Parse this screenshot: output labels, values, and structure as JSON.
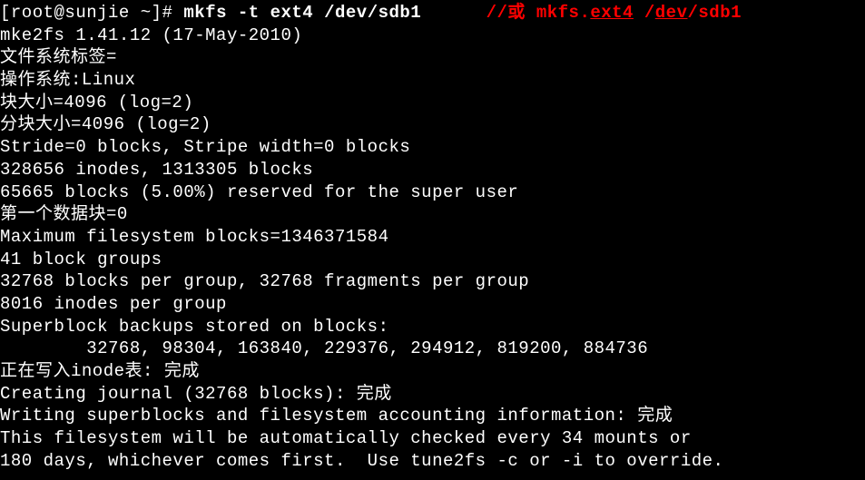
{
  "prompt": {
    "open": "[",
    "userhost": "root@sunjie ~",
    "close": "]# ",
    "command": "mkfs -t ext4 /dev/sdb1",
    "spacer": "      ",
    "comment_prefix": "//或 mkfs.",
    "comment_ext": "ext4",
    "comment_mid": " /",
    "comment_dev": "dev",
    "comment_suffix": "/sdb1"
  },
  "output": {
    "l1": "mke2fs 1.41.12 (17-May-2010)",
    "l2": "文件系统标签=",
    "l3": "操作系统:Linux",
    "l4": "块大小=4096 (log=2)",
    "l5": "分块大小=4096 (log=2)",
    "l6": "Stride=0 blocks, Stripe width=0 blocks",
    "l7": "328656 inodes, 1313305 blocks",
    "l8": "65665 blocks (5.00%) reserved for the super user",
    "l9": "第一个数据块=0",
    "l10": "Maximum filesystem blocks=1346371584",
    "l11": "41 block groups",
    "l12": "32768 blocks per group, 32768 fragments per group",
    "l13": "8016 inodes per group",
    "l14": "Superblock backups stored on blocks: ",
    "l15": "        32768, 98304, 163840, 229376, 294912, 819200, 884736",
    "l16": "",
    "l17": "正在写入inode表: 完成",
    "l18": "Creating journal (32768 blocks): 完成",
    "l19": "Writing superblocks and filesystem accounting information: 完成",
    "l20": "",
    "l21": "This filesystem will be automatically checked every 34 mounts or",
    "l22": "180 days, whichever comes first.  Use tune2fs -c or -i to override."
  }
}
